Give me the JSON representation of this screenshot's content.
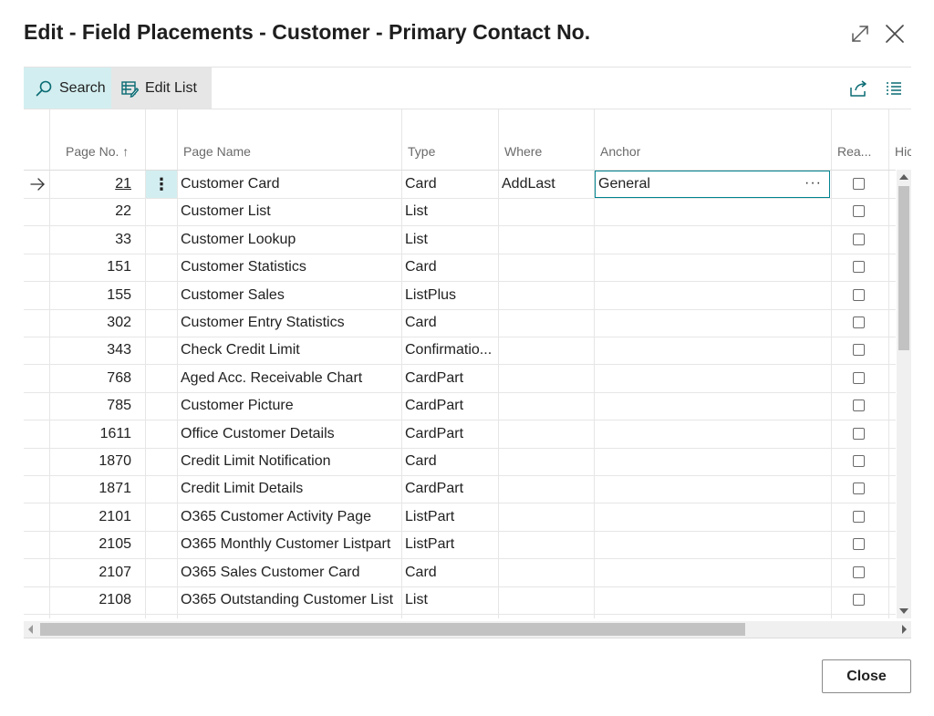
{
  "dialog": {
    "title": "Edit - Field Placements - Customer - Primary Contact No.",
    "close_button": "Close"
  },
  "toolbar": {
    "search_label": "Search",
    "edit_list_label": "Edit List"
  },
  "icons": {
    "expand": "expand-icon",
    "close": "close-x-icon",
    "search": "search-icon",
    "edit_list": "edit-list-icon",
    "share": "share-icon",
    "list_view": "list-view-icon",
    "row_arrow": "arrow-right-icon",
    "row_menu": "vertical-ellipsis-icon"
  },
  "colors": {
    "accent": "#00838f",
    "selected_bg": "#d3eef0",
    "button_bg": "#e6e6e6"
  },
  "columns": {
    "page_no": "Page No.",
    "sort_indicator": "↑",
    "page_name": "Page Name",
    "type": "Type",
    "where": "Where",
    "anchor": "Anchor",
    "read_only": "Rea...",
    "hide": "Hic"
  },
  "rows": [
    {
      "page_no": "21",
      "page_name": "Customer Card",
      "type": "Card",
      "where": "AddLast",
      "anchor": "General",
      "read_only": false
    },
    {
      "page_no": "22",
      "page_name": "Customer List",
      "type": "List",
      "where": "",
      "anchor": "",
      "read_only": false
    },
    {
      "page_no": "33",
      "page_name": "Customer Lookup",
      "type": "List",
      "where": "",
      "anchor": "",
      "read_only": false
    },
    {
      "page_no": "151",
      "page_name": "Customer Statistics",
      "type": "Card",
      "where": "",
      "anchor": "",
      "read_only": false
    },
    {
      "page_no": "155",
      "page_name": "Customer Sales",
      "type": "ListPlus",
      "where": "",
      "anchor": "",
      "read_only": false
    },
    {
      "page_no": "302",
      "page_name": "Customer Entry Statistics",
      "type": "Card",
      "where": "",
      "anchor": "",
      "read_only": false
    },
    {
      "page_no": "343",
      "page_name": "Check Credit Limit",
      "type": "Confirmatio...",
      "where": "",
      "anchor": "",
      "read_only": false
    },
    {
      "page_no": "768",
      "page_name": "Aged Acc. Receivable Chart",
      "type": "CardPart",
      "where": "",
      "anchor": "",
      "read_only": false
    },
    {
      "page_no": "785",
      "page_name": "Customer Picture",
      "type": "CardPart",
      "where": "",
      "anchor": "",
      "read_only": false
    },
    {
      "page_no": "1611",
      "page_name": "Office Customer Details",
      "type": "CardPart",
      "where": "",
      "anchor": "",
      "read_only": false
    },
    {
      "page_no": "1870",
      "page_name": "Credit Limit Notification",
      "type": "Card",
      "where": "",
      "anchor": "",
      "read_only": false
    },
    {
      "page_no": "1871",
      "page_name": "Credit Limit Details",
      "type": "CardPart",
      "where": "",
      "anchor": "",
      "read_only": false
    },
    {
      "page_no": "2101",
      "page_name": "O365 Customer Activity Page",
      "type": "ListPart",
      "where": "",
      "anchor": "",
      "read_only": false
    },
    {
      "page_no": "2105",
      "page_name": "O365 Monthly Customer Listpart",
      "type": "ListPart",
      "where": "",
      "anchor": "",
      "read_only": false
    },
    {
      "page_no": "2107",
      "page_name": "O365 Sales Customer Card",
      "type": "Card",
      "where": "",
      "anchor": "",
      "read_only": false
    },
    {
      "page_no": "2108",
      "page_name": "O365 Outstanding Customer List",
      "type": "List",
      "where": "",
      "anchor": "",
      "read_only": false
    }
  ]
}
